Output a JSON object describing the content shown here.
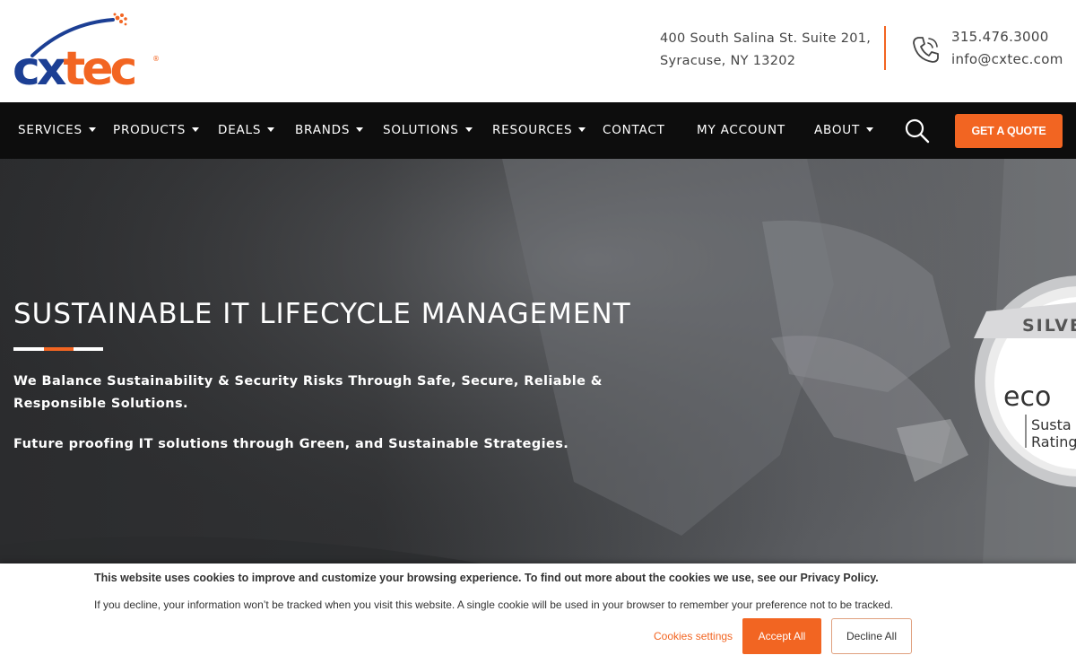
{
  "logo": {
    "text": "cxtec",
    "registered": "®"
  },
  "header": {
    "address_line1": "400 South Salina St. Suite 201,",
    "address_line2": "Syracuse, NY 13202",
    "phone": "315.476.3000",
    "email": "info@cxtec.com"
  },
  "nav": {
    "items": [
      {
        "label": "SERVICES",
        "dropdown": true
      },
      {
        "label": "PRODUCTS",
        "dropdown": true
      },
      {
        "label": "DEALS",
        "dropdown": true
      },
      {
        "label": "BRANDS",
        "dropdown": true
      },
      {
        "label": "SOLUTIONS",
        "dropdown": true
      },
      {
        "label": "RESOURCES",
        "dropdown": true
      },
      {
        "label": "CONTACT",
        "dropdown": false
      },
      {
        "label": "MY ACCOUNT",
        "dropdown": false
      },
      {
        "label": "ABOUT",
        "dropdown": true
      }
    ],
    "quote_label": "GET A QUOTE"
  },
  "hero": {
    "title": "SUSTAINABLE IT LIFECYCLE MANAGEMENT",
    "paragraph1": "We Balance Sustainability & Security Risks Through Safe, Secure, Reliable & Responsible Solutions.",
    "paragraph2": "Future proofing IT solutions through Green, and Sustainable Strategies."
  },
  "badge": {
    "ribbon": "SILVE",
    "brand": "eco",
    "line1": "Susta",
    "line2": "Rating"
  },
  "cookie": {
    "line1": "This website uses cookies to improve and customize your browsing experience. To find out more about the cookies we use, see our Privacy Policy.",
    "line2": "If you decline, your information won’t be tracked when you visit this website. A single cookie will be used in your browser to remember your preference not to be tracked.",
    "settings_label": "Cookies settings",
    "accept_label": "Accept All",
    "decline_label": "Decline All"
  },
  "colors": {
    "accent": "#f26522",
    "brand_blue": "#1c3f94",
    "nav_bg": "#0d0d0d"
  },
  "icons": [
    "phone-icon",
    "search-icon",
    "caret-down-icon"
  ]
}
